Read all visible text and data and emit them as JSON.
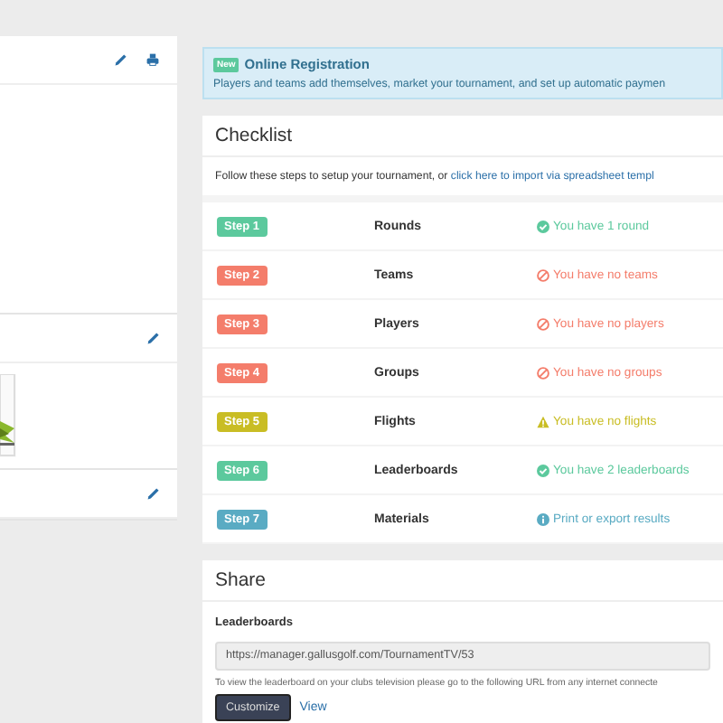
{
  "registration": {
    "badge": "New",
    "title": "Online Registration",
    "text": "Players and teams add themselves, market your tournament, and set up automatic paymen"
  },
  "checklist": {
    "title": "Checklist",
    "intro": "Follow these steps to setup your tournament, or ",
    "intro_link": "click here to import via spreadsheet templ",
    "steps": [
      {
        "badge": "Step 1",
        "name": "Rounds",
        "status": "You have 1 round",
        "kind": "done"
      },
      {
        "badge": "Step 2",
        "name": "Teams",
        "status": "You have no teams",
        "kind": "missing"
      },
      {
        "badge": "Step 3",
        "name": "Players",
        "status": "You have no players",
        "kind": "missing"
      },
      {
        "badge": "Step 4",
        "name": "Groups",
        "status": "You have no groups",
        "kind": "missing"
      },
      {
        "badge": "Step 5",
        "name": "Flights",
        "status": "You have no flights",
        "kind": "warning"
      },
      {
        "badge": "Step 6",
        "name": "Leaderboards",
        "status": "You have 2 leaderboards",
        "kind": "done"
      },
      {
        "badge": "Step 7",
        "name": "Materials",
        "status": "Print or export results",
        "kind": "info"
      }
    ]
  },
  "share": {
    "title": "Share",
    "label": "Leaderboards",
    "url": "https://manager.gallusgolf.com/TournamentTV/53",
    "help": "To view the leaderboard on your clubs television please go to the following URL from any internet connecte",
    "buttons": [
      {
        "label": "Customize",
        "kind": "primary"
      },
      {
        "label": "View",
        "kind": "link"
      }
    ]
  }
}
